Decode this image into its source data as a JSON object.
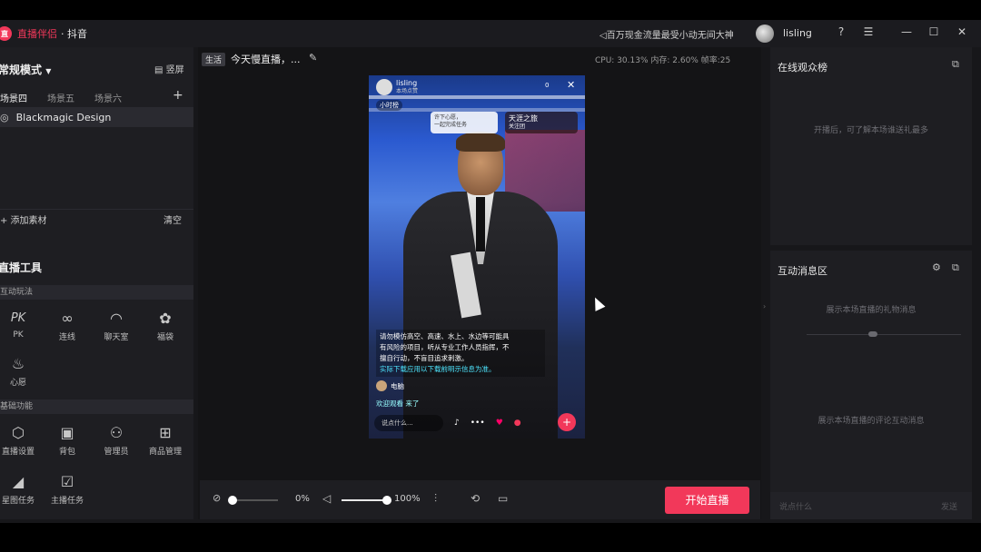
{
  "titlebar": {
    "logo_text": "直",
    "app_name": "直播伴侣",
    "app_sub": "· 抖音",
    "notice": "百万现金流量最受小动无间大神",
    "username": "lisling",
    "icons": [
      "help-icon",
      "menu-icon",
      "minimize-icon",
      "maximize-icon",
      "close-icon"
    ],
    "icon_glyphs": [
      "?",
      "☰",
      "—",
      "☐",
      "✕"
    ]
  },
  "left": {
    "mode_label": "常规模式",
    "fullscreen_label": "竖屏",
    "scenes": [
      "场景四",
      "场景五",
      "场景六"
    ],
    "scene_add": "+",
    "source_name": "Blackmagic Design",
    "add_material": "+ 添加素材",
    "clear": "清空",
    "tools_title": "直播工具",
    "section_interactive": "互动玩法",
    "section_basic": "基础功能",
    "interactive_tools": [
      {
        "glyph": "PK",
        "label": "PK"
      },
      {
        "glyph": "∞",
        "label": "连线"
      },
      {
        "glyph": "◠",
        "label": "聊天室"
      },
      {
        "glyph": "✿",
        "label": "福袋"
      },
      {
        "glyph": "♨",
        "label": "心愿"
      }
    ],
    "basic_tools": [
      {
        "glyph": "⬡",
        "label": "直播设置"
      },
      {
        "glyph": "▣",
        "label": "背包"
      },
      {
        "glyph": "⚇",
        "label": "管理员"
      },
      {
        "glyph": "⊞",
        "label": "商品管理"
      },
      {
        "glyph": "◢",
        "label": "星图任务"
      },
      {
        "glyph": "☑",
        "label": "主播任务"
      }
    ]
  },
  "center": {
    "live_tag": "生活",
    "live_title": "今天慢直播，...",
    "stats": "CPU: 30.13%  内存: 2.60%  帧率:25",
    "phone": {
      "username": "lisling",
      "sub": "本场点赞",
      "count": "0",
      "chip": "小时榜",
      "card1_line1": "许下心愿，",
      "card1_line2": "一起完成任务",
      "card2_line1": "天涯之旅",
      "card2_line2": "关注团",
      "notice_lines": [
        "请勿模仿高空、高速、水上、水边等可能具",
        "有风险的项目，听从专业工作人员指挥，不",
        "擅自行动，不盲目追求刺激。"
      ],
      "notice_cyan": "实际下载应用以下载前明示信息为准。",
      "user_msg": "电脑",
      "join_msg": "欢迎观看 来了",
      "input_placeholder": "说点什么...",
      "plus": "+"
    }
  },
  "bottombar": {
    "mic_pct": "0%",
    "mic_level": 0,
    "vol_pct": "100%",
    "vol_level": 1.0,
    "start_label": "开始直播"
  },
  "right": {
    "audience_title": "在线观众榜",
    "audience_hint": "开播后，可了解本场谁送礼最多",
    "msg_title": "互动消息区",
    "gift_hint": "展示本场直播的礼物消息",
    "comment_hint": "展示本场直播的评论互动消息",
    "input_placeholder": "说点什么",
    "send_label": "发送"
  },
  "colors": {
    "accent": "#f2385a",
    "panel": "#1e1e22",
    "background": "#17171a"
  }
}
